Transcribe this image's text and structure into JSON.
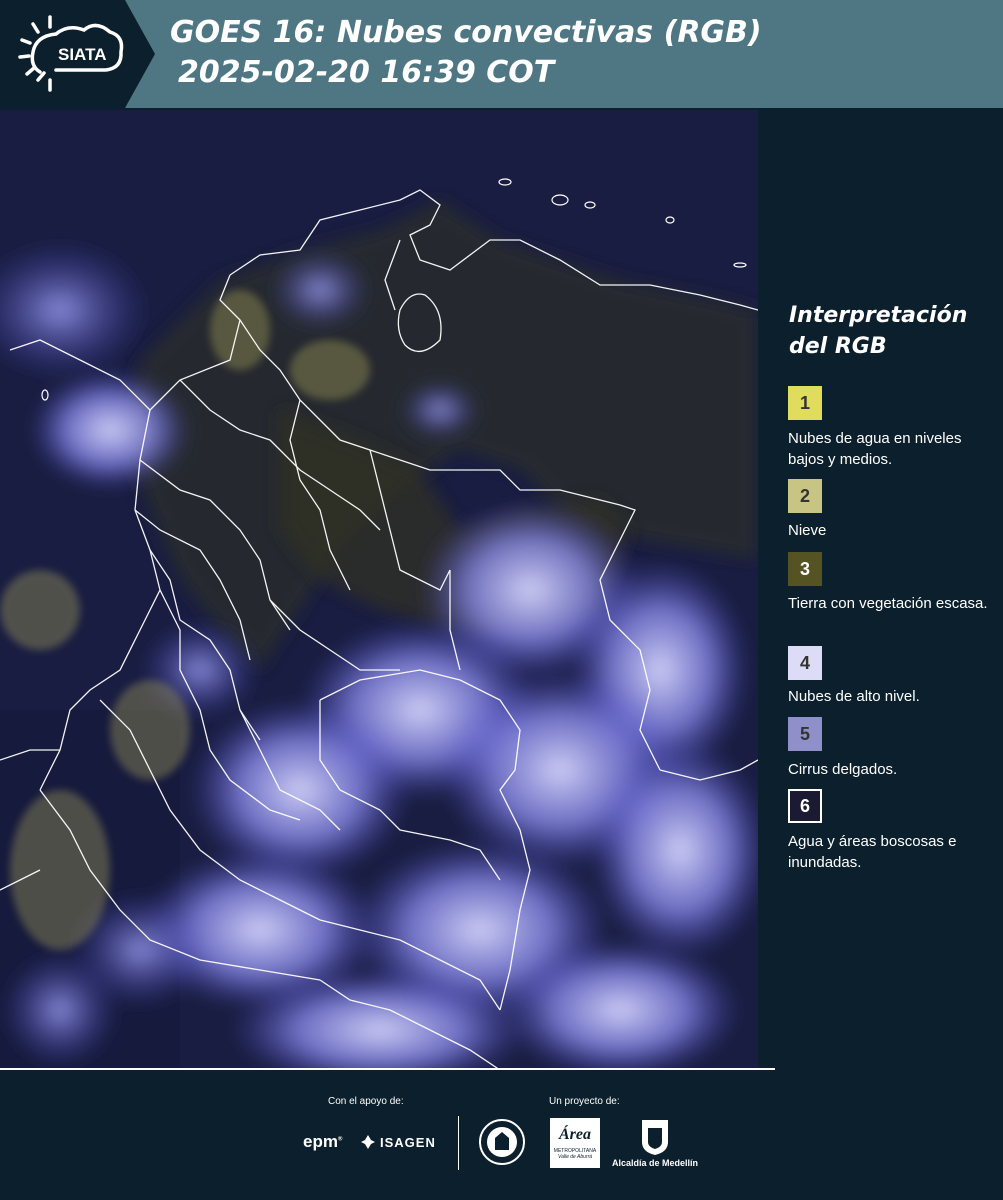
{
  "header": {
    "title_line1": "GOES 16: Nubes convectivas (RGB)",
    "title_line2": "2025-02-20 16:39 COT",
    "logo_text": "SIATA"
  },
  "legend": {
    "title_line1": "Interpretación",
    "title_line2": "del RGB",
    "items": [
      {
        "num": "1",
        "color": "#e0dd5c",
        "label": "Nubes de agua en niveles bajos y medios."
      },
      {
        "num": "2",
        "color": "#c8c584",
        "label": "Nieve"
      },
      {
        "num": "3",
        "color": "#555224",
        "label": "Tierra con vegetación escasa."
      },
      {
        "num": "4",
        "color": "#dcdcf6",
        "label": "Nubes de alto nivel."
      },
      {
        "num": "5",
        "color": "#8f8fca",
        "label": "Cirrus delgados."
      },
      {
        "num": "6",
        "color": "#1a1a33",
        "label": "Agua y áreas boscosas e inundadas."
      }
    ]
  },
  "footer": {
    "support_caption": "Con el apoyo de:",
    "project_caption": "Un proyecto de:",
    "epm": "epm",
    "isagen": "ISAGEN",
    "area_name": "Área",
    "area_sub1": "METROPOLITANA",
    "area_sub2": "Valle de Aburrá",
    "alcaldia": "Alcaldía de Medellín",
    "seal_text": "MEDELLÍN"
  }
}
